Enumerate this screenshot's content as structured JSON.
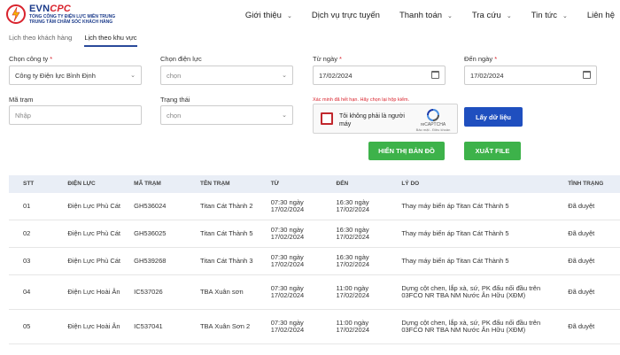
{
  "header": {
    "logo_evn": "EVN",
    "logo_cpc": "CPC",
    "logo_sub1": "TỔNG CÔNG TY ĐIỆN LỰC MIỀN TRUNG",
    "logo_sub2": "TRUNG TÂM CHĂM SÓC KHÁCH HÀNG",
    "nav": [
      {
        "label": "Giới thiệu",
        "chevron": true
      },
      {
        "label": "Dịch vụ trực tuyến",
        "chevron": false
      },
      {
        "label": "Thanh toán",
        "chevron": true
      },
      {
        "label": "Tra cứu",
        "chevron": true
      },
      {
        "label": "Tin tức",
        "chevron": true
      },
      {
        "label": "Liên hệ",
        "chevron": false
      }
    ]
  },
  "tabs": [
    {
      "label": "Lịch theo khách hàng",
      "active": false
    },
    {
      "label": "Lịch theo khu vực",
      "active": true
    }
  ],
  "form": {
    "company_label": "Chọn công ty",
    "company_value": "Công ty Điện lực Bình Định",
    "branch_label": "Chọn điện lực",
    "branch_value": "chọn",
    "from_label": "Từ ngày",
    "from_value": "17/02/2024",
    "to_label": "Đến ngày",
    "to_value": "17/02/2024",
    "station_label": "Mã trạm",
    "station_placeholder": "Nhập",
    "status_label": "Trạng thái",
    "status_value": "chọn",
    "required_mark": "*"
  },
  "captcha": {
    "error": "Xác minh đã hết hạn. Hãy chọn lại hộp kiểm.",
    "text": "Tôi không phải là người máy",
    "brand": "reCAPTCHA",
    "links": "Bảo mật - Điều khoản"
  },
  "buttons": {
    "fetch": "Lấy dữ liệu",
    "map": "HIỂN THỊ BẢN ĐỒ",
    "export": "XUẤT FILE"
  },
  "table": {
    "headers": [
      "STT",
      "ĐIỆN LỰC",
      "MÃ TRẠM",
      "TÊN TRẠM",
      "TỪ",
      "ĐẾN",
      "LÝ DO",
      "TÌNH TRẠNG"
    ],
    "rows": [
      {
        "stt": "01",
        "dien_luc": "Điện Lực Phù Cát",
        "ma_tram": "GH536024",
        "ten_tram": "Titan Cát Thành 2",
        "tu": "07:30 ngày 17/02/2024",
        "den": "16:30 ngày 17/02/2024",
        "ly_do": "Thay máy biến áp Titan Cát Thành 5",
        "tinh_trang": "Đã duyệt"
      },
      {
        "stt": "02",
        "dien_luc": "Điện Lực Phù Cát",
        "ma_tram": "GH536025",
        "ten_tram": "Titan Cát Thành 5",
        "tu": "07:30 ngày 17/02/2024",
        "den": "16:30 ngày 17/02/2024",
        "ly_do": "Thay máy biến áp Titan Cát Thành 5",
        "tinh_trang": "Đã duyệt"
      },
      {
        "stt": "03",
        "dien_luc": "Điện Lực Phù Cát",
        "ma_tram": "GH539268",
        "ten_tram": "Titan Cát Thành 3",
        "tu": "07:30 ngày 17/02/2024",
        "den": "16:30 ngày 17/02/2024",
        "ly_do": "Thay máy biến áp Titan Cát Thành 5",
        "tinh_trang": "Đã duyệt"
      },
      {
        "stt": "04",
        "dien_luc": "Điện Lực Hoài Ân",
        "ma_tram": "IC537026",
        "ten_tram": "TBA Xuân sơn",
        "tu": "07:30 ngày 17/02/2024",
        "den": "11:00 ngày 17/02/2024",
        "ly_do": "Dựng cột chen, lắp xà, sứ, PK đấu nối đầu trên 03FCO NR TBA NM Nước Ân Hữu (XĐM)",
        "tinh_trang": "Đã duyệt"
      },
      {
        "stt": "05",
        "dien_luc": "Điện Lực Hoài Ân",
        "ma_tram": "IC537041",
        "ten_tram": "TBA Xuân Sơn 2",
        "tu": "07:30 ngày 17/02/2024",
        "den": "11:00 ngày 17/02/2024",
        "ly_do": "Dựng cột chen, lắp xà, sứ, PK đấu nối đầu trên 03FCO NR TBA NM Nước Ân Hữu (XĐM)",
        "tinh_trang": "Đã duyệt"
      }
    ]
  }
}
